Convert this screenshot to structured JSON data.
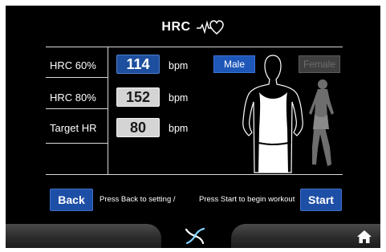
{
  "header": {
    "title": "HRC",
    "icon": "heart-rate-icon"
  },
  "rows": [
    {
      "label": "HRC 60%",
      "value": "114",
      "unit": "bpm",
      "state": "active"
    },
    {
      "label": "HRC 80%",
      "value": "152",
      "unit": "bpm",
      "state": "inactive"
    },
    {
      "label": "Target HR",
      "value": "80",
      "unit": "bpm",
      "state": "inactive"
    }
  ],
  "gender": {
    "male_label": "Male",
    "female_label": "Female",
    "selected": "Male"
  },
  "footer": {
    "back_label": "Back",
    "back_hint": "Press Back to setting /",
    "start_hint": "Press Start to begin workout",
    "start_label": "Start"
  },
  "bottom_bar": {
    "center_icon": "fan-icon",
    "home_icon": "home-icon"
  },
  "colors": {
    "background": "#000000",
    "accent_blue": "#1e4fa6",
    "inactive_field": "#d4d4d4",
    "line": "#d9d9d9"
  }
}
